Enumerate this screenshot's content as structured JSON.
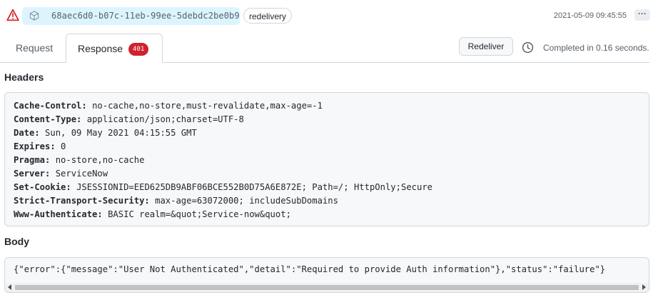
{
  "delivery": {
    "guid": "68aec6d0-b07c-11eb-99ee-5debdc2be0b9",
    "badge": "redelivery",
    "timestamp": "2021-05-09 09:45:55",
    "more_label": "···",
    "status_icon": "alert-triangle-icon",
    "event_icon": "cube-icon"
  },
  "tabs": [
    {
      "label": "Request",
      "active": false
    },
    {
      "label": "Response",
      "active": true,
      "badge": "401"
    }
  ],
  "actions": {
    "redeliver_label": "Redeliver",
    "completed_text": "Completed in 0.16 seconds."
  },
  "headers_section": {
    "title": "Headers",
    "items": [
      {
        "name": "Cache-Control:",
        "value": "no-cache,no-store,must-revalidate,max-age=-1"
      },
      {
        "name": "Content-Type:",
        "value": "application/json;charset=UTF-8"
      },
      {
        "name": "Date:",
        "value": "Sun, 09 May 2021 04:15:55 GMT"
      },
      {
        "name": "Expires:",
        "value": "0"
      },
      {
        "name": "Pragma:",
        "value": "no-store,no-cache"
      },
      {
        "name": "Server:",
        "value": "ServiceNow"
      },
      {
        "name": "Set-Cookie:",
        "value": "JSESSIONID=EED625DB9ABF06BCE552B0D75A6E872E; Path=/; HttpOnly;Secure"
      },
      {
        "name": "Strict-Transport-Security:",
        "value": "max-age=63072000; includeSubDomains"
      },
      {
        "name": "Www-Authenticate:",
        "value": "BASIC realm=&quot;Service-now&quot;"
      }
    ]
  },
  "body_section": {
    "title": "Body",
    "content": "{\"error\":{\"message\":\"User Not Authenticated\",\"detail\":\"Required to provide Auth information\"},\"status\":\"failure\"}"
  },
  "colors": {
    "alert": "#cf222e",
    "guid_pill_bg": "#ddf4ff",
    "badge_bg": "#cf222e"
  }
}
